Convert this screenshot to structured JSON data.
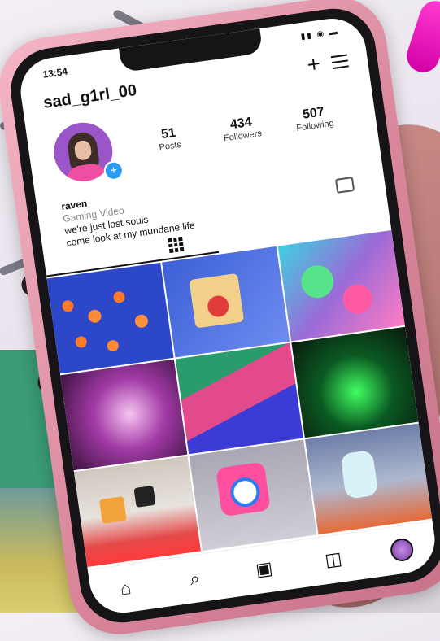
{
  "status_bar": {
    "time": "13:54",
    "icons": "▮▮ ◉ ▬"
  },
  "profile": {
    "username": "sad_g1rl_00",
    "name": "raven",
    "category": "Gaming Video",
    "bio_line1": "we're just lost souls",
    "bio_line2": "come look at my mundane life"
  },
  "stats": [
    {
      "value": "51",
      "label": "Posts"
    },
    {
      "value": "434",
      "label": "Followers"
    },
    {
      "value": "507",
      "label": "Following"
    }
  ],
  "icons": {
    "plus": "+",
    "home": "⌂",
    "search": "⌕",
    "reels": "▣",
    "shop": "◫"
  },
  "colors": {
    "case_pink": "#d9869b",
    "accent_blue": "#2b9cf0",
    "avatar_purple": "#9a55c9"
  }
}
